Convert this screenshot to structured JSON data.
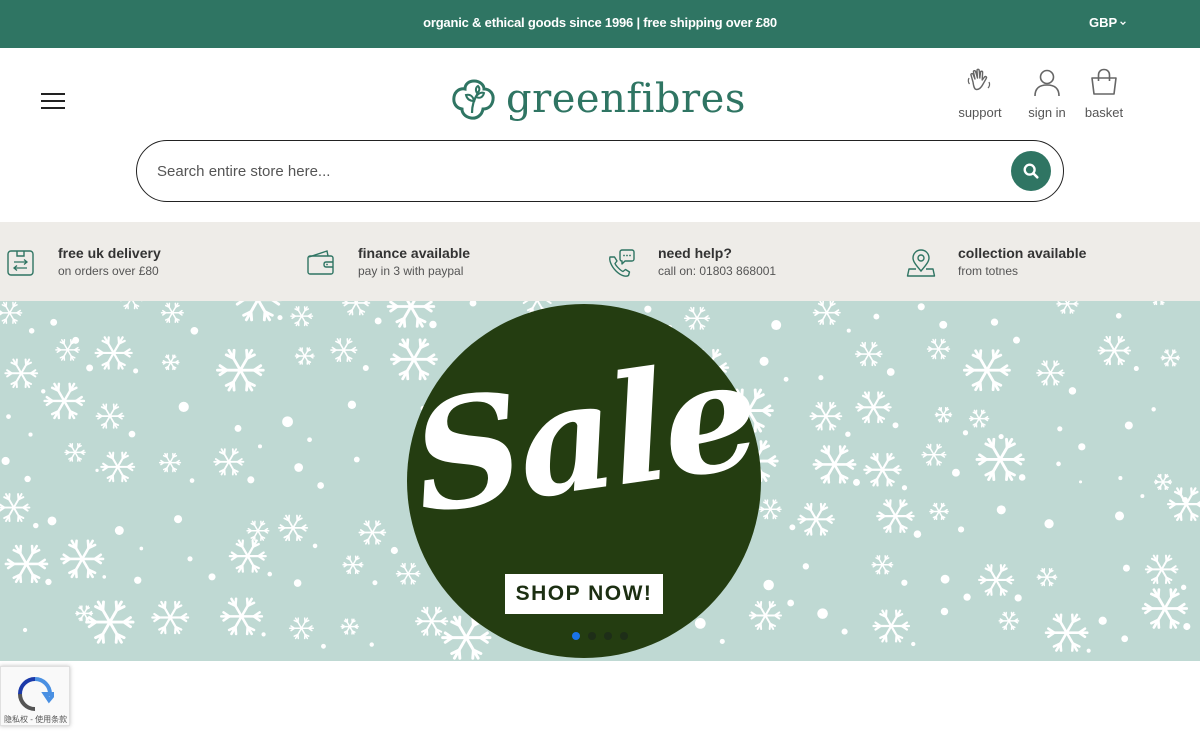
{
  "topbar": {
    "promo": "organic & ethical goods since 1996 | free shipping over £80",
    "currency": "GBP"
  },
  "brand": {
    "name": "greenfibres"
  },
  "header": {
    "support_label": "support",
    "signin_label": "sign in",
    "basket_label": "basket"
  },
  "search": {
    "placeholder": "Search entire store here..."
  },
  "usps": [
    {
      "title": "free uk delivery",
      "sub": "on orders over £80"
    },
    {
      "title": "finance available",
      "sub": "pay in 3 with paypal"
    },
    {
      "title": "need help?",
      "sub": "call on: 01803 868001"
    },
    {
      "title": "collection available",
      "sub": "from totnes"
    }
  ],
  "hero": {
    "headline": "Sale",
    "cta": "SHOP NOW!",
    "slide_count": 4,
    "active_slide": 1
  },
  "recaptcha": {
    "text": "隐私权 - 使用条款"
  },
  "colors": {
    "brand_green": "#2f7563",
    "usp_bg": "#eeece8",
    "hero_bg": "#bfd9d3",
    "sale_circle": "#243d11",
    "active_dot": "#1a73e8"
  }
}
